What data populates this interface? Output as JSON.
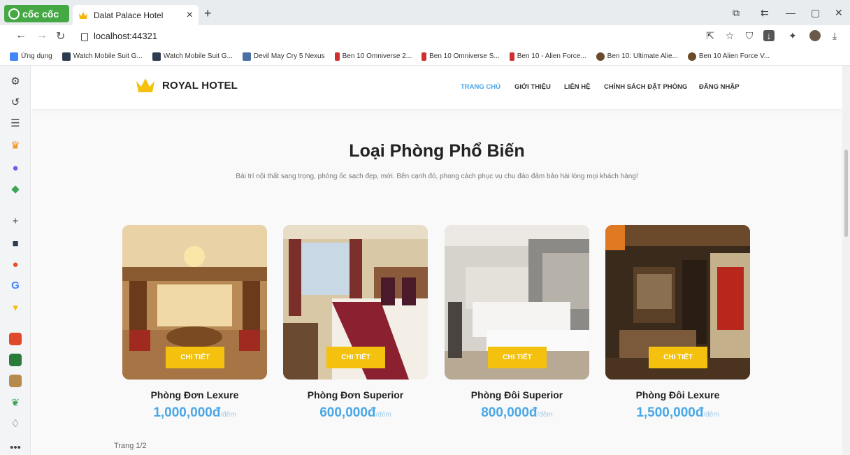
{
  "browser": {
    "brand": "cốc cốc",
    "tab_title": "Dalat Palace Hotel",
    "url": "localhost:44321",
    "bookmarks": [
      {
        "label": "Ứng dụng",
        "color": "#4285f4"
      },
      {
        "label": "Watch Mobile Suit G...",
        "color": "#2d3d50"
      },
      {
        "label": "Watch Mobile Suit G...",
        "color": "#2d3d50"
      },
      {
        "label": "Devil May Cry 5 Nexus",
        "color": "#4a6fa5"
      },
      {
        "label": "Ben 10 Omniverse 2...",
        "color": "#d02f2f"
      },
      {
        "label": "Ben 10 Omniverse S...",
        "color": "#d02f2f"
      },
      {
        "label": "Ben 10 - Alien Force...",
        "color": "#d02f2f"
      },
      {
        "label": "Ben 10: Ultimate Alie...",
        "color": "#6b4a2a"
      },
      {
        "label": "Ben 10 Alien Force V...",
        "color": "#6b4a2a"
      }
    ]
  },
  "site": {
    "logo_text": "ROYAL HOTEL",
    "accent": "#f3c10e",
    "menu": [
      "TRANG CHỦ",
      "GIỚI THIỆU",
      "LIÊN HỆ",
      "CHÍNH SÁCH ĐẶT PHÒNG",
      "ĐĂNG NHẬP"
    ],
    "active_menu_color": "#4aa8e6"
  },
  "section": {
    "title": "Loại Phòng Phổ Biến",
    "subtitle": "Bài trí nội thất sang trọng, phòng ốc sạch đẹp, mới. Bên cạnh đó, phong cách phục vụ chu đáo đảm bảo hài lòng mọi khách hàng!"
  },
  "rooms": [
    {
      "name": "Phòng Đơn Lexure",
      "price": "1,000,000đ",
      "unit": "/đêm",
      "button": "CHI TIẾT"
    },
    {
      "name": "Phòng Đơn Superior",
      "price": "600,000đ",
      "unit": "/đêm",
      "button": "CHI TIẾT"
    },
    {
      "name": "Phòng Đôi Superior",
      "price": "800,000đ",
      "unit": "/đêm",
      "button": "CHI TIẾT"
    },
    {
      "name": "Phòng Đôi Lexure",
      "price": "1,500,000đ",
      "unit": "/đêm",
      "button": "CHI TIẾT"
    }
  ],
  "pager": "Trang 1/2"
}
